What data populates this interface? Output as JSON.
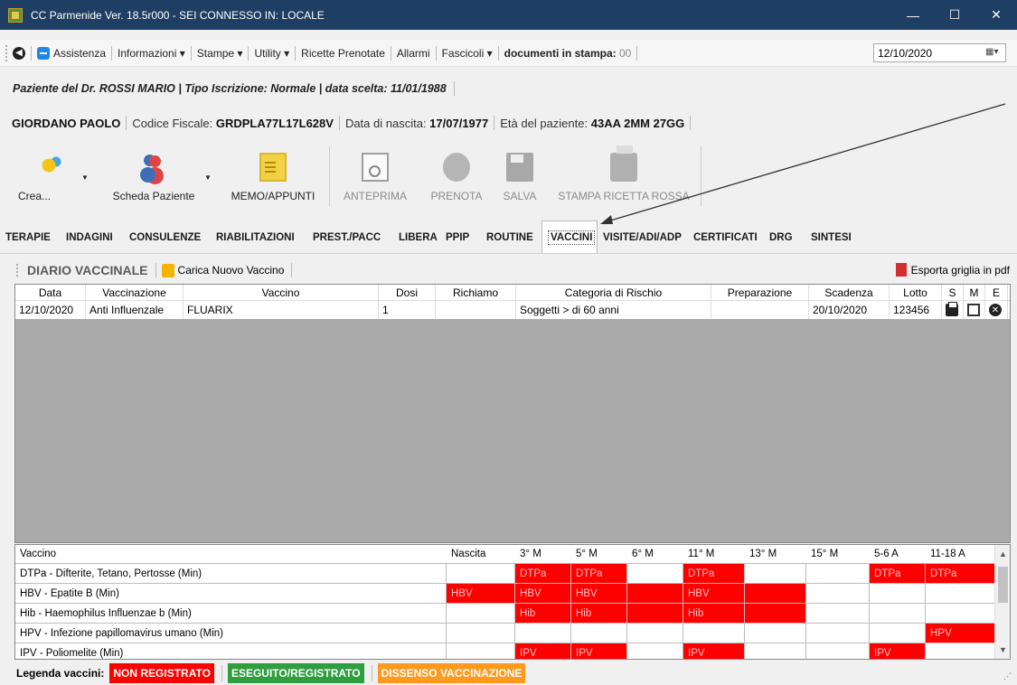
{
  "window": {
    "title": "CC Parmenide Ver. 18.5r000 - SEI CONNESSO IN: LOCALE"
  },
  "menu": {
    "items": [
      "Assistenza",
      "Informazioni ▾",
      "Stampe ▾",
      "Utility ▾",
      "Ricette Prenotate",
      "Allarmi",
      "Fascicoli ▾"
    ],
    "docs_label": "documenti in stampa:",
    "docs_count": "00",
    "date": "12/10/2020"
  },
  "patient_bar": {
    "doctor": "Paziente del Dr. ROSSI MARIO",
    "iscrizione": "Tipo Iscrizione: Normale",
    "data_scelta": "data scelta: 11/01/1988"
  },
  "identity": {
    "name": "GIORDANO PAOLO",
    "cf_label": "Codice Fiscale:",
    "cf_value": "GRDPLA77L17L628V",
    "dob_label": "Data di nascita:",
    "dob_value": "17/07/1977",
    "age_label": "Età del paziente:",
    "age_value": "43AA 2MM 27GG"
  },
  "toolbar": {
    "crea": "Crea...",
    "scheda": "Scheda Paziente",
    "memo": "MEMO/APPUNTI",
    "anteprima": "ANTEPRIMA",
    "prenota": "PRENOTA",
    "salva": "SALVA",
    "stampa": "STAMPA RICETTA ROSSA"
  },
  "tabs": [
    "TERAPIE",
    "INDAGINI",
    "CONSULENZE",
    "RIABILITAZIONI",
    "PREST./PACC",
    "LIBERA",
    "PPIP",
    "ROUTINE",
    "VACCINI",
    "VISITE/ADI/ADP",
    "CERTIFICATI",
    "DRG",
    "SINTESI"
  ],
  "active_tab": "VACCINI",
  "diary": {
    "title": "DIARIO VACCINALE",
    "load_label": "Carica Nuovo Vaccino",
    "export_label": "Esporta griglia in pdf"
  },
  "record_grid": {
    "headers": [
      "Data",
      "Vaccinazione",
      "Vaccino",
      "Dosi",
      "Richiamo",
      "Categoria di Rischio",
      "Preparazione",
      "Scadenza",
      "Lotto",
      "S",
      "M",
      "E"
    ],
    "rows": [
      [
        "12/10/2020",
        "Anti Influenzale",
        "FLUARIX",
        "1",
        "",
        "Soggetti > di 60 anni",
        "",
        "20/10/2020",
        "123456"
      ]
    ]
  },
  "schedule_grid": {
    "headers": [
      "Vaccino",
      "Nascita",
      "3° M",
      "5° M",
      "6° M",
      "11° M",
      "13° M",
      "15° M",
      "5-6 A",
      "11-18 A"
    ],
    "rows": [
      {
        "name": "DTPa - Difterite, Tetano, Pertosse (Min)",
        "cells": [
          "",
          "DTPa",
          "DTPa",
          "",
          "DTPa",
          "",
          "",
          "DTPa",
          "DTPa"
        ]
      },
      {
        "name": "HBV - Epatite B (Min)",
        "cells": [
          "HBV",
          "HBV",
          "HBV",
          "",
          "HBV",
          "",
          "",
          "",
          ""
        ]
      },
      {
        "name": "Hib - Haemophilus Influenzae b (Min)",
        "cells": [
          "",
          "Hib",
          "Hib",
          "",
          "Hib",
          "",
          "",
          "",
          ""
        ]
      },
      {
        "name": "HPV - Infezione papillomavirus umano (Min)",
        "cells": [
          "",
          "",
          "",
          "",
          "",
          "",
          "",
          "",
          "HPV"
        ]
      },
      {
        "name": "IPV - Poliomelite (Min)",
        "cells": [
          "",
          "IPV",
          "IPV",
          "",
          "IPV",
          "",
          "",
          "IPV",
          ""
        ]
      }
    ],
    "red_fill": [
      [
        false,
        true,
        true,
        false,
        true,
        false,
        false,
        true,
        true
      ],
      [
        true,
        true,
        true,
        true,
        true,
        true,
        false,
        false,
        false
      ],
      [
        false,
        true,
        true,
        true,
        true,
        true,
        false,
        false,
        false
      ],
      [
        false,
        false,
        false,
        false,
        false,
        false,
        false,
        false,
        true
      ],
      [
        false,
        true,
        true,
        false,
        true,
        false,
        false,
        true,
        false
      ]
    ]
  },
  "legend": {
    "label": "Legenda vaccini:",
    "not_registered": "NON REGISTRATO",
    "done": "ESEGUITO/REGISTRATO",
    "dissent": "DISSENSO VACCINAZIONE"
  },
  "colors": {
    "title_bar": "#1f3e63",
    "red": "#ff0000",
    "green": "#2e9e3e",
    "orange": "#ff9a1e"
  }
}
